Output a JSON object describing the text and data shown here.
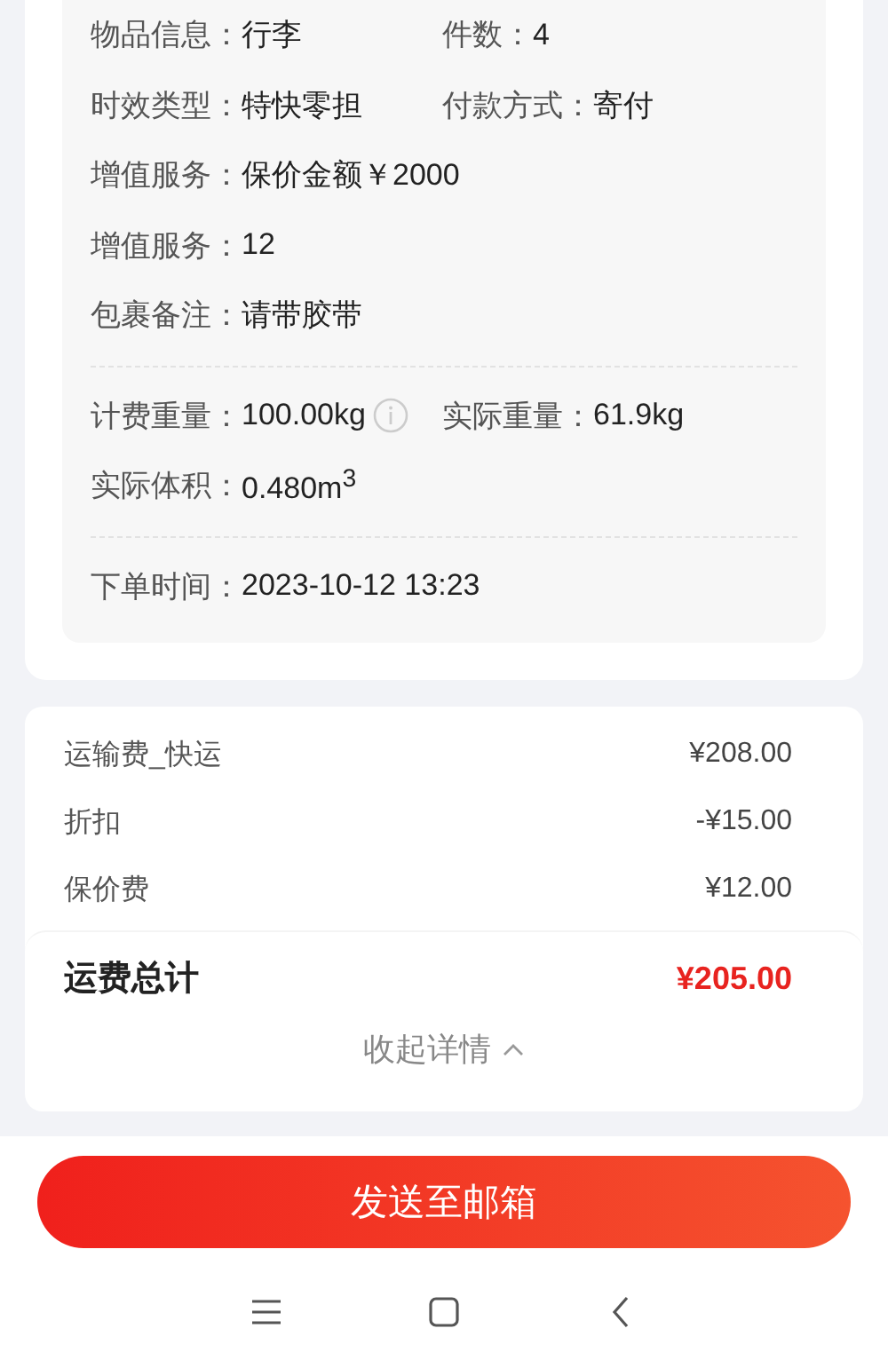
{
  "details": {
    "groups": [
      [
        [
          {
            "label": "物品信息：",
            "value": "行李"
          },
          {
            "label": "件数：",
            "value": "4"
          }
        ],
        [
          {
            "label": "时效类型：",
            "value": "特快零担"
          },
          {
            "label": "付款方式：",
            "value": "寄付"
          }
        ],
        [
          {
            "label": "增值服务：",
            "value": "保价金额￥2000"
          }
        ],
        [
          {
            "label": "增值服务：",
            "value": "12"
          }
        ],
        [
          {
            "label": "包裹备注：",
            "value": "请带胶带"
          }
        ]
      ],
      [
        [
          {
            "label": "计费重量：",
            "value": "100.00kg",
            "info": true
          },
          {
            "label": "实际重量：",
            "value": "61.9kg"
          }
        ],
        [
          {
            "label": "实际体积：",
            "value": "0.480m$^{3}$"
          }
        ]
      ],
      [
        [
          {
            "label": "下单时间：",
            "value": "2023-10-12 13:23"
          }
        ]
      ]
    ]
  },
  "fees": {
    "items": [
      {
        "name": "运输费_快运",
        "amount": "¥208.00"
      },
      {
        "name": "折扣",
        "amount": "-¥15.00"
      },
      {
        "name": "保价费",
        "amount": "¥12.00"
      }
    ],
    "total": {
      "label": "运费总计",
      "amount": "¥205.00"
    },
    "collapse": {
      "label": "收起详情",
      "expanded": true
    }
  },
  "action_button": "发送至邮箱"
}
